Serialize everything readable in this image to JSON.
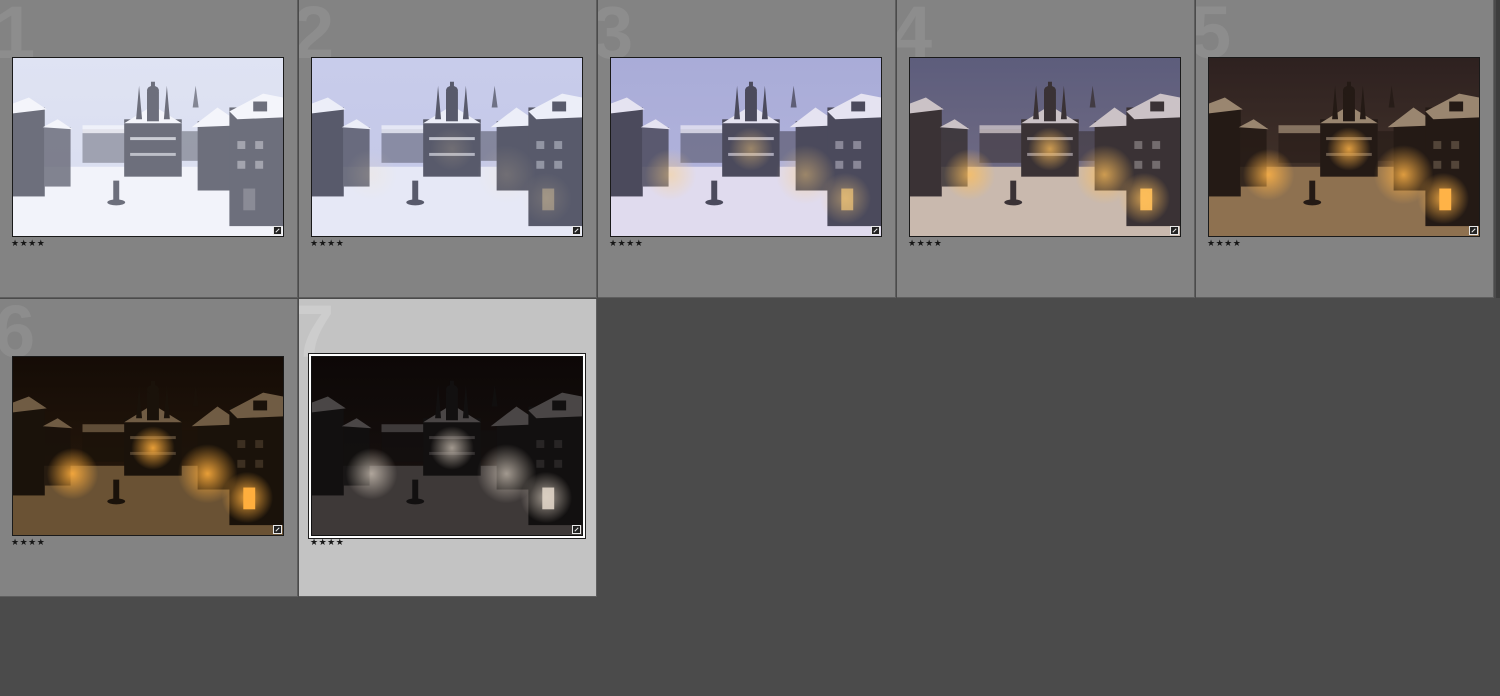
{
  "grid": {
    "cells": [
      {
        "index": "1",
        "rating": "★★★★",
        "selected": false,
        "sky": "#dfe3f3",
        "haze": "#d8dcef",
        "snow": "#f2f3fa",
        "bldg": "#6d6f7c",
        "roof": "#f4f5fb",
        "glow": "#ffffff",
        "glowOpacity": 0.0
      },
      {
        "index": "2",
        "rating": "★★★★",
        "selected": false,
        "sky": "#c8cceb",
        "haze": "#c3c7e6",
        "snow": "#e6e8f6",
        "bldg": "#585a6b",
        "roof": "#eceef8",
        "glow": "#ffe2a8",
        "glowOpacity": 0.15
      },
      {
        "index": "3",
        "rating": "★★★★",
        "selected": false,
        "sky": "#a9acd8",
        "haze": "#b4b5dc",
        "snow": "#e0dbee",
        "bldg": "#4b4a5c",
        "roof": "#e5e3f1",
        "glow": "#ffcf7a",
        "glowOpacity": 0.45
      },
      {
        "index": "4",
        "rating": "★★★★",
        "selected": false,
        "sky": "#5d5d7c",
        "haze": "#787187",
        "snow": "#c9b9ae",
        "bldg": "#3a3235",
        "roof": "#cbc2c6",
        "glow": "#ffbf5a",
        "glowOpacity": 0.75
      },
      {
        "index": "5",
        "rating": "★★★★",
        "selected": false,
        "sky": "#2e2120",
        "haze": "#4b3a2e",
        "snow": "#8e7150",
        "bldg": "#241a15",
        "roof": "#9a8670",
        "glow": "#ffb347",
        "glowOpacity": 0.85
      },
      {
        "index": "6",
        "rating": "★★★★",
        "selected": false,
        "sky": "#150c06",
        "haze": "#2a1b0d",
        "snow": "#6a5234",
        "bldg": "#1a120a",
        "roof": "#705c44",
        "glow": "#ffae3d",
        "glowOpacity": 0.9
      },
      {
        "index": "7",
        "rating": "★★★★",
        "selected": true,
        "sky": "#0d0807",
        "haze": "#1a1311",
        "snow": "#3e3938",
        "bldg": "#121010",
        "roof": "#4a4646",
        "glow": "#e0d4c6",
        "glowOpacity": 0.7
      }
    ]
  }
}
